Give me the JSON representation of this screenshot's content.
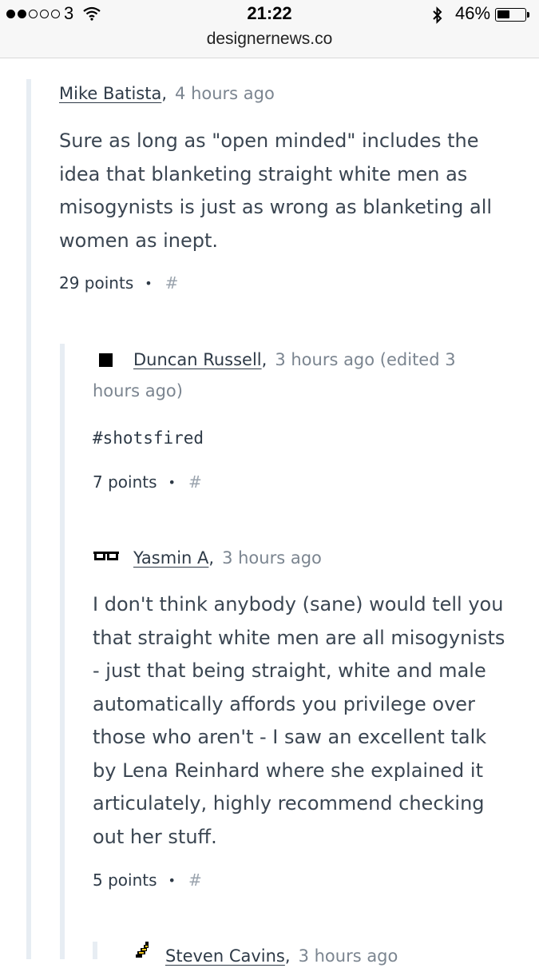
{
  "status_bar": {
    "carrier": "3",
    "time": "21:22",
    "battery_percent": "46%",
    "battery_level": 0.46,
    "signal_bars_filled": 2,
    "signal_bars_total": 5,
    "icons": [
      "wifi-icon",
      "bluetooth-icon",
      "battery-icon"
    ]
  },
  "browser": {
    "url": "designernews.co"
  },
  "comments": [
    {
      "author": "Mike Batista",
      "separator": ",",
      "time": "4 hours ago",
      "body_lines": [
        "Sure as long as \"open minded\" includes the",
        "idea that blanketing straight white men as",
        "misogynists is just as wrong as blanketing all",
        "women as inept."
      ],
      "points": "29 points",
      "bullet": "•",
      "permalink": "#"
    },
    {
      "author": "Duncan Russell",
      "separator": ",",
      "time_line1": "3 hours ago (edited 3",
      "time_line2": "hours ago)",
      "avatar_icon": "black-square-icon",
      "body": "#shotsfired",
      "points": "7 points",
      "bullet": "•",
      "permalink": "#"
    },
    {
      "author": "Yasmin A",
      "separator": ",",
      "time": "3 hours ago",
      "avatar_icon": "pixel-glasses-icon",
      "body_lines": [
        "I don't think anybody (sane) would tell you",
        "that straight white men are all misogynists",
        "- just that being straight, white and male",
        "automatically affords you privilege over",
        "those who aren't - I saw an excellent talk",
        "by Lena Reinhard where she explained it",
        "articulately, highly recommend checking",
        "out her stuff."
      ],
      "points": "5 points",
      "bullet": "•",
      "permalink": "#"
    },
    {
      "author": "Steven Cavins",
      "separator": ",",
      "time": "3 hours ago",
      "avatar_icon": "pixel-banana-icon"
    }
  ],
  "colors": {
    "text": "#2e3a47",
    "muted": "#7b8590",
    "thread_line": "#e7edf3",
    "hash": "#9aa3ad"
  }
}
